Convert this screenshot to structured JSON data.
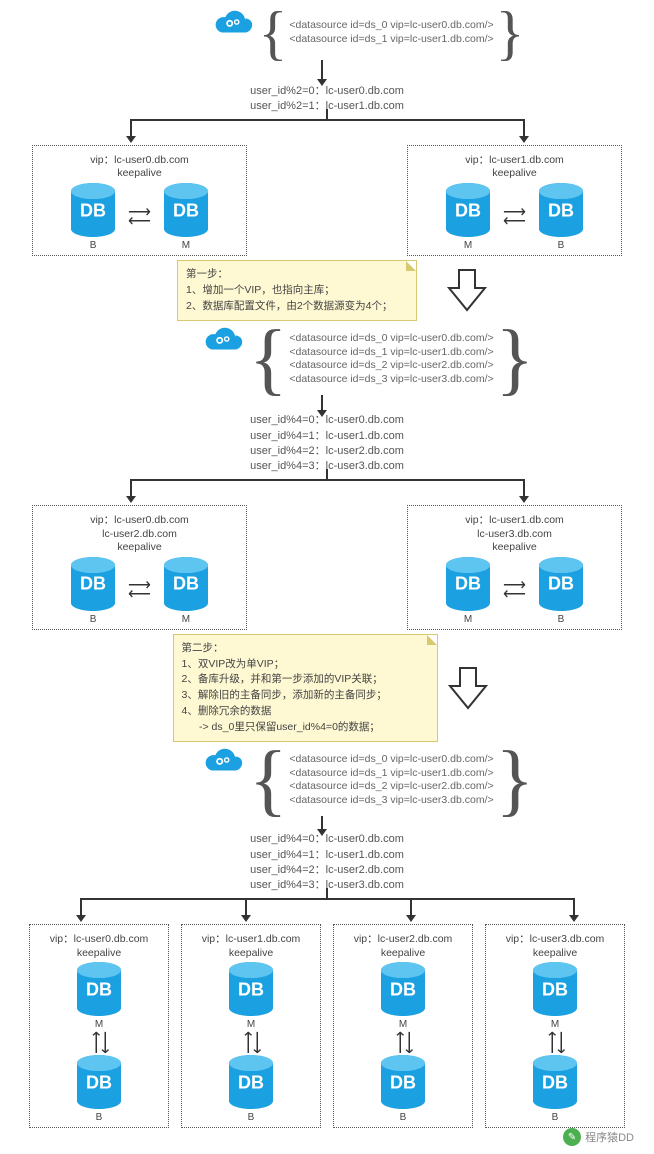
{
  "stage1": {
    "config": [
      "<datasource id=ds_0 vip=lc-user0.db.com/>",
      "<datasource id=ds_1 vip=lc-user1.db.com/>"
    ],
    "rules": [
      "user_id%2=0：lc-user0.db.com",
      "user_id%2=1：lc-user1.db.com"
    ],
    "cluster_left": {
      "title1": "vip：lc-user0.db.com",
      "title2": "keepalive",
      "left_role": "B",
      "right_role": "M"
    },
    "cluster_right": {
      "title1": "vip：lc-user1.db.com",
      "title2": "keepalive",
      "left_role": "M",
      "right_role": "B"
    }
  },
  "note1": {
    "title": "第一步：",
    "lines": [
      "1、增加一个VIP，也指向主库；",
      "2、数据库配置文件，由2个数据源变为4个；"
    ]
  },
  "stage2": {
    "config": [
      "<datasource id=ds_0 vip=lc-user0.db.com/>",
      "<datasource id=ds_1 vip=lc-user1.db.com/>",
      "<datasource id=ds_2 vip=lc-user2.db.com/>",
      "<datasource id=ds_3 vip=lc-user3.db.com/>"
    ],
    "rules": [
      "user_id%4=0：lc-user0.db.com",
      "user_id%4=1：lc-user1.db.com",
      "user_id%4=2：lc-user2.db.com",
      "user_id%4=3：lc-user3.db.com"
    ],
    "cluster_left": {
      "title1": "vip：lc-user0.db.com",
      "title2": "lc-user2.db.com",
      "title3": "keepalive",
      "left_role": "B",
      "right_role": "M"
    },
    "cluster_right": {
      "title1": "vip：lc-user1.db.com",
      "title2": "lc-user3.db.com",
      "title3": "keepalive",
      "left_role": "M",
      "right_role": "B"
    }
  },
  "note2": {
    "title": "第二步：",
    "lines": [
      "1、双VIP改为单VIP；",
      "2、备库升级，并和第一步添加的VIP关联；",
      "3、解除旧的主备同步，添加新的主备同步；",
      "4、删除冗余的数据",
      "      -> ds_0里只保留user_id%4=0的数据；"
    ]
  },
  "stage3": {
    "config": [
      "<datasource id=ds_0 vip=lc-user0.db.com/>",
      "<datasource id=ds_1 vip=lc-user1.db.com/>",
      "<datasource id=ds_2 vip=lc-user2.db.com/>",
      "<datasource id=ds_3 vip=lc-user3.db.com/>"
    ],
    "rules": [
      "user_id%4=0：lc-user0.db.com",
      "user_id%4=1：lc-user1.db.com",
      "user_id%4=2：lc-user2.db.com",
      "user_id%4=3：lc-user3.db.com"
    ],
    "clusters": [
      {
        "title1": "vip：lc-user0.db.com",
        "title2": "keepalive",
        "top_role": "M",
        "bottom_role": "B"
      },
      {
        "title1": "vip：lc-user1.db.com",
        "title2": "keepalive",
        "top_role": "M",
        "bottom_role": "B"
      },
      {
        "title1": "vip：lc-user2.db.com",
        "title2": "keepalive",
        "top_role": "M",
        "bottom_role": "B"
      },
      {
        "title1": "vip：lc-user3.db.com",
        "title2": "keepalive",
        "top_role": "M",
        "bottom_role": "B"
      }
    ]
  },
  "db_text": "DB",
  "footer": "程序猿DD"
}
